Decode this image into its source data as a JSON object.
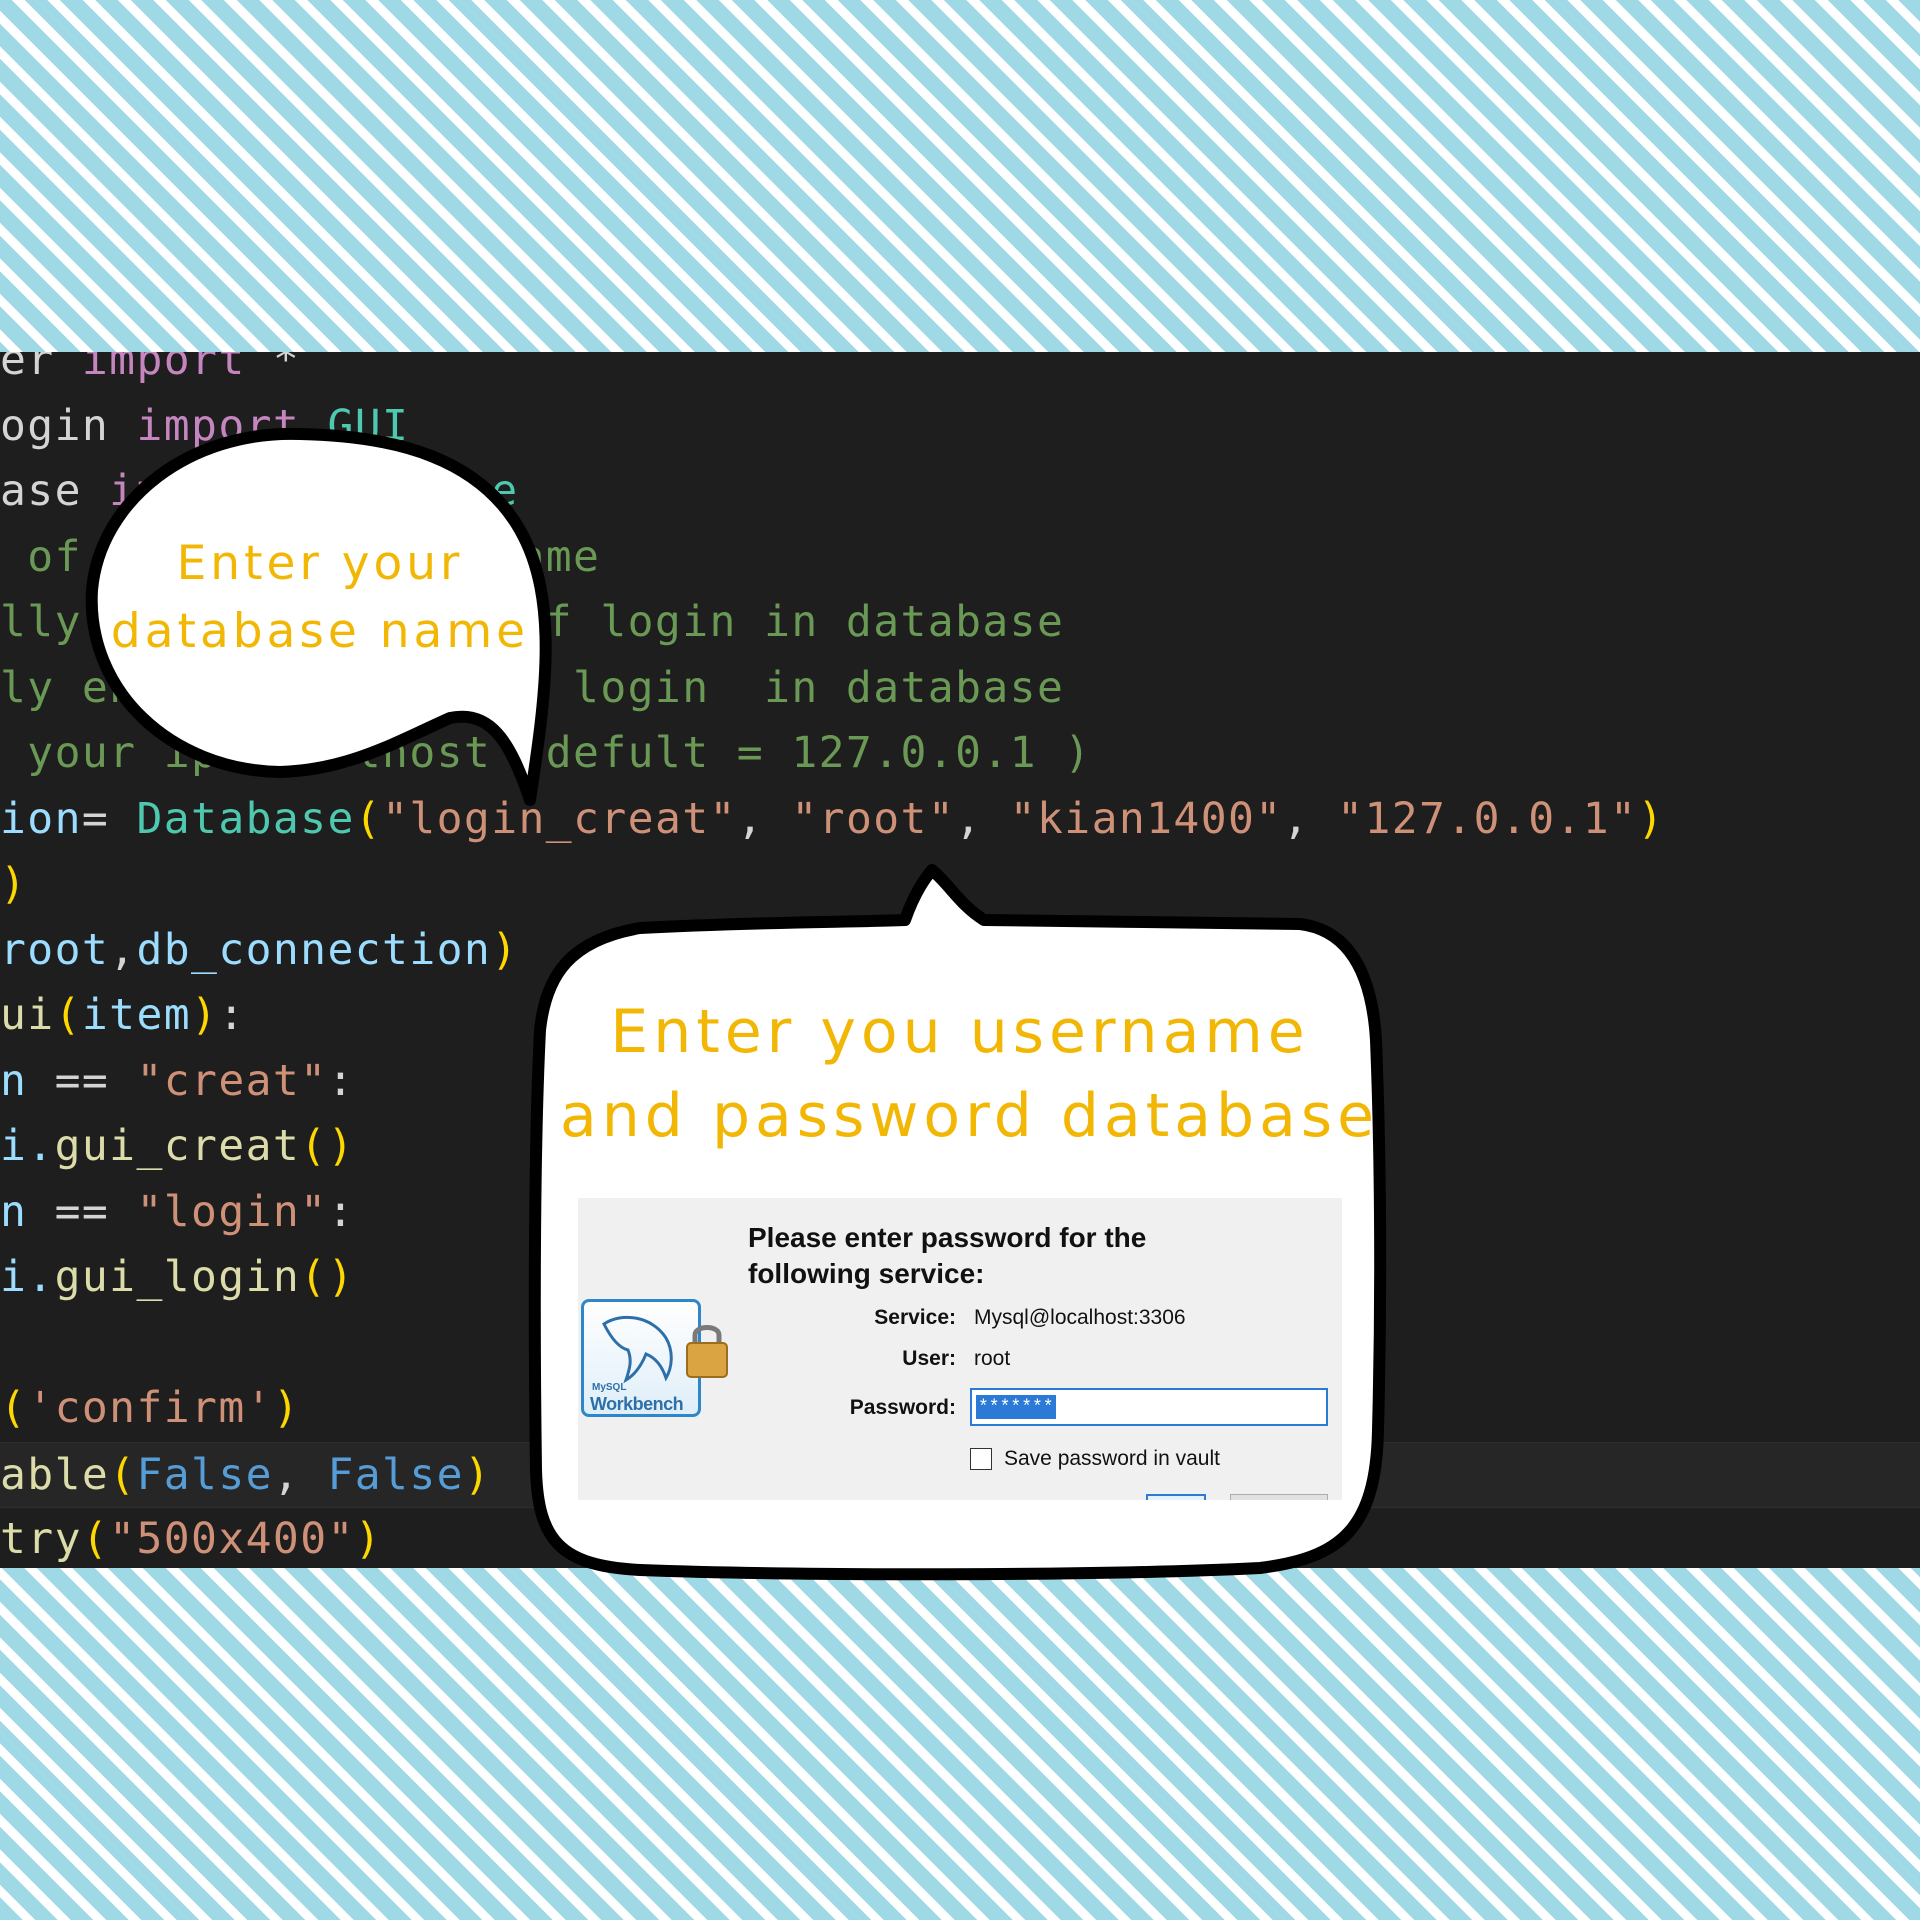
{
  "code_lines": [
    {
      "tokens": [
        {
          "t": "er ",
          "c": "df"
        },
        {
          "t": "import",
          "c": "kw"
        },
        {
          "t": " *",
          "c": "df"
        }
      ]
    },
    {
      "tokens": [
        {
          "t": "ogin ",
          "c": "df"
        },
        {
          "t": "import",
          "c": "kw"
        },
        {
          "t": " GUI",
          "c": "cls"
        }
      ]
    },
    {
      "tokens": [
        {
          "t": "ase ",
          "c": "df"
        },
        {
          "t": "import",
          "c": "kw"
        },
        {
          "t": " Database",
          "c": "cls"
        }
      ]
    },
    {
      "tokens": [
        {
          "t": " of your database name",
          "c": "cm"
        }
      ]
    },
    {
      "tokens": [
        {
          "t": "lly enter username of login in database",
          "c": "cm"
        }
      ]
    },
    {
      "tokens": [
        {
          "t": "ly enter password of login  in database",
          "c": "cm"
        }
      ]
    },
    {
      "tokens": [
        {
          "t": " your ip localhost (defult = 127.0.0.1 )",
          "c": "cm"
        }
      ]
    },
    {
      "tokens": [
        {
          "t": "ion",
          "c": "vr"
        },
        {
          "t": "= ",
          "c": "df"
        },
        {
          "t": "Database",
          "c": "cls"
        },
        {
          "t": "(",
          "c": "br"
        },
        {
          "t": "\"login_creat\"",
          "c": "str"
        },
        {
          "t": ", ",
          "c": "df"
        },
        {
          "t": "\"root\"",
          "c": "str"
        },
        {
          "t": ", ",
          "c": "df"
        },
        {
          "t": "\"kian1400\"",
          "c": "str"
        },
        {
          "t": ", ",
          "c": "df"
        },
        {
          "t": "\"127.0.0.1\"",
          "c": "str"
        },
        {
          "t": ")",
          "c": "br"
        }
      ]
    },
    {
      "tokens": [
        {
          "t": ")",
          "c": "br"
        }
      ]
    },
    {
      "tokens": [
        {
          "t": "root",
          "c": "vr"
        },
        {
          "t": ",",
          "c": "df"
        },
        {
          "t": "db_connection",
          "c": "vr"
        },
        {
          "t": ")",
          "c": "br"
        }
      ]
    },
    {
      "tokens": [
        {
          "t": "ui",
          "c": "fn"
        },
        {
          "t": "(",
          "c": "br"
        },
        {
          "t": "item",
          "c": "vr"
        },
        {
          "t": ")",
          "c": "br"
        },
        {
          "t": ":",
          "c": "df"
        }
      ]
    },
    {
      "tokens": [
        {
          "t": "n ",
          "c": "vr"
        },
        {
          "t": "== ",
          "c": "df"
        },
        {
          "t": "\"creat\"",
          "c": "str"
        },
        {
          "t": ":",
          "c": "df"
        }
      ]
    },
    {
      "tokens": [
        {
          "t": "i.",
          "c": "vr"
        },
        {
          "t": "gui_creat",
          "c": "fn"
        },
        {
          "t": "()",
          "c": "br"
        }
      ]
    },
    {
      "tokens": [
        {
          "t": "n ",
          "c": "vr"
        },
        {
          "t": "== ",
          "c": "df"
        },
        {
          "t": "\"login\"",
          "c": "str"
        },
        {
          "t": ":",
          "c": "df"
        }
      ]
    },
    {
      "tokens": [
        {
          "t": "i.",
          "c": "vr"
        },
        {
          "t": "gui_login",
          "c": "fn"
        },
        {
          "t": "()",
          "c": "br"
        }
      ]
    },
    {
      "tokens": []
    },
    {
      "tokens": [
        {
          "t": "(",
          "c": "br"
        },
        {
          "t": "'confirm'",
          "c": "str"
        },
        {
          "t": ")",
          "c": "br"
        }
      ]
    },
    {
      "tokens": [
        {
          "t": "able",
          "c": "fn"
        },
        {
          "t": "(",
          "c": "br"
        },
        {
          "t": "False",
          "c": "cn"
        },
        {
          "t": ", ",
          "c": "df"
        },
        {
          "t": "False",
          "c": "cn"
        },
        {
          "t": ")",
          "c": "br"
        }
      ],
      "active": true
    },
    {
      "tokens": [
        {
          "t": "try",
          "c": "fn"
        },
        {
          "t": "(",
          "c": "br"
        },
        {
          "t": "\"500x400\"",
          "c": "str"
        },
        {
          "t": ")",
          "c": "br"
        }
      ]
    }
  ],
  "bubble_db": {
    "line1": "Enter your",
    "line2": "database name"
  },
  "bubble_user": {
    "line1": "Enter you username",
    "line2": "and password database"
  },
  "dialog": {
    "heading_line1": "Please enter password for the",
    "heading_line2": "following service:",
    "service_label": "Service:",
    "service_value": "Mysql@localhost:3306",
    "user_label": "User:",
    "user_value": "root",
    "password_label": "Password:",
    "password_value": "*******",
    "save_label": "Save password in vault",
    "save_checked": false,
    "logo_text": "Workbench",
    "logo_small": "MySQL"
  },
  "colors": {
    "bubble_text": "#f2b705",
    "code_bg": "#1e1e1e",
    "stripe": "#9fd9e6"
  }
}
